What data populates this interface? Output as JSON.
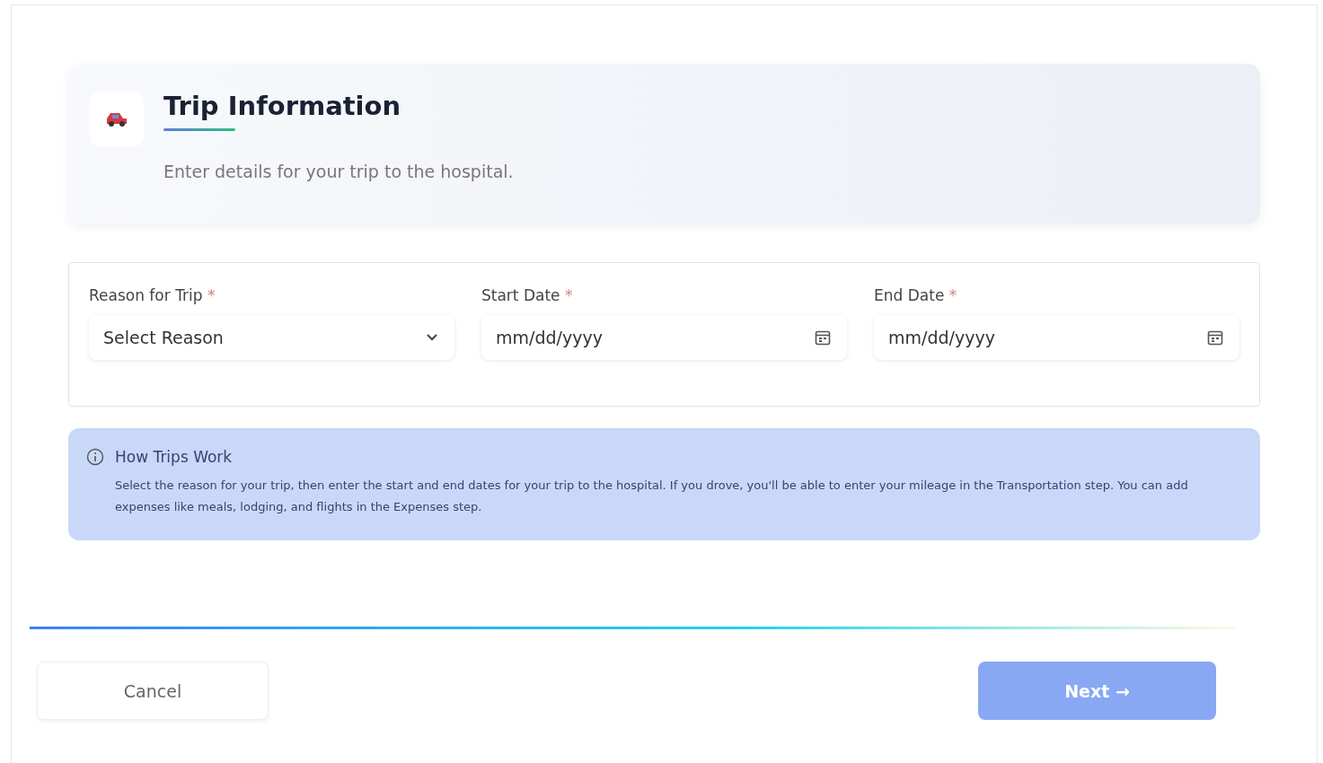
{
  "header": {
    "title": "Trip Information",
    "subtitle": "Enter details for your trip to the hospital."
  },
  "fields": [
    {
      "kind": "select",
      "label": "Reason for Trip",
      "required_mark": "*",
      "placeholder": "Select Reason"
    },
    {
      "kind": "date",
      "label": "Start Date",
      "required_mark": "*",
      "placeholder": "mm/dd/yyyy"
    },
    {
      "kind": "date",
      "label": "End Date",
      "required_mark": "*",
      "placeholder": "mm/dd/yyyy"
    }
  ],
  "info": {
    "title": "How Trips Work",
    "text": "Select the reason for your trip, then enter the start and end dates for your trip to the hospital. If you drove, you'll be able to enter your mileage in the Transportation step. You can add expenses like meals, lodging, and flights in the Expenses step."
  },
  "buttons": [
    {
      "kind": "secondary",
      "label": "Cancel",
      "disabled": false
    },
    {
      "kind": "primary",
      "label": "Next →",
      "disabled": true
    }
  ]
}
